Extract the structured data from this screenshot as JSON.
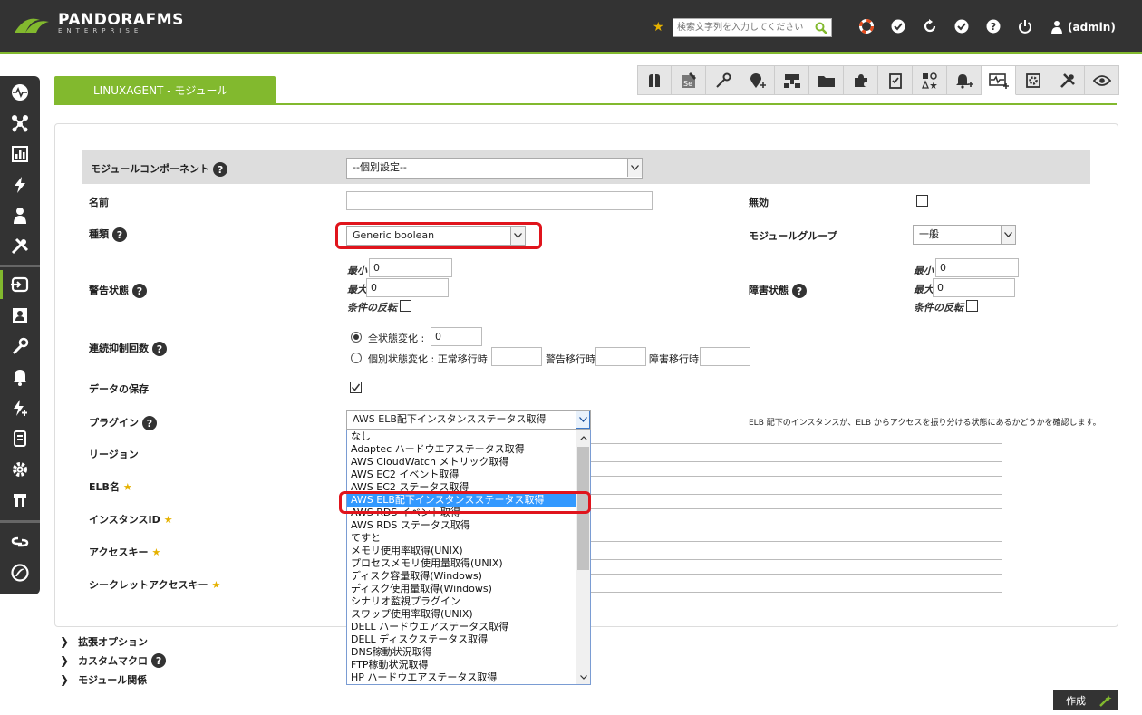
{
  "header": {
    "brand": "PANDORAFMS",
    "brand_sub": "ENTERPRISE",
    "search_placeholder": "検索文字列を入力してください",
    "user": "(admin)"
  },
  "tab": {
    "title": "LINUXAGENT - モジュール"
  },
  "form": {
    "component_label": "モジュールコンポーネント",
    "component_value": "--個別設定--",
    "name_label": "名前",
    "name_value": "",
    "disabled_label": "無効",
    "type_label": "種類",
    "type_value": "Generic boolean",
    "group_label": "モジュールグループ",
    "group_value": "一般",
    "warning_label": "警告状態",
    "critical_label": "障害状態",
    "min_label": "最小",
    "max_label": "最大",
    "invert_label": "条件の反転",
    "warning_min": "0",
    "warning_max": "0",
    "critical_min": "0",
    "critical_max": "0",
    "ff_label": "連続抑制回数",
    "ff_all_label": "全状態変化 :",
    "ff_all_value": "0",
    "ff_each_label": "個別状態変化 : 正常移行時",
    "ff_warning_label": "警告移行時",
    "ff_critical_label": "障害移行時",
    "save_data_label": "データの保存",
    "plugin_label": "プラグイン",
    "plugin_value": "AWS ELB配下インスタンスステータス取得",
    "plugin_desc": "ELB 配下のインスタンスが、ELB からアクセスを振り分ける状態にあるかどうかを確認します。",
    "region_label": "リージョン",
    "elb_label": "ELB名",
    "instance_label": "インスタンスID",
    "access_key_label": "アクセスキー",
    "secret_key_label": "シークレットアクセスキー"
  },
  "plugin_options": [
    "なし",
    "Adaptec ハードウエアステータス取得",
    "AWS CloudWatch メトリック取得",
    "AWS EC2 イベント取得",
    "AWS EC2 ステータス取得",
    "AWS ELB配下インスタンスステータス取得",
    "AWS RDS イベント取得",
    "AWS RDS ステータス取得",
    "てすと",
    "メモリ使用率取得(UNIX)",
    "プロセスメモリ使用量取得(UNIX)",
    "ディスク容量取得(Windows)",
    "ディスク使用量取得(Windows)",
    "シナリオ監視プラグイン",
    "スワップ使用率取得(UNIX)",
    "DELL ハードウエアステータス取得",
    "DELL ディスクステータス取得",
    "DNS稼動状況取得",
    "FTP稼動状況取得",
    "HP ハードウエアステータス取得"
  ],
  "sections": {
    "advanced": "拡張オプション",
    "macros": "カスタムマクロ",
    "relations": "モジュール関係"
  },
  "create_button": "作成",
  "colors": {
    "accent": "#82b92e",
    "dark": "#333333",
    "highlight": "#e0141c",
    "selection": "#3399ff"
  }
}
